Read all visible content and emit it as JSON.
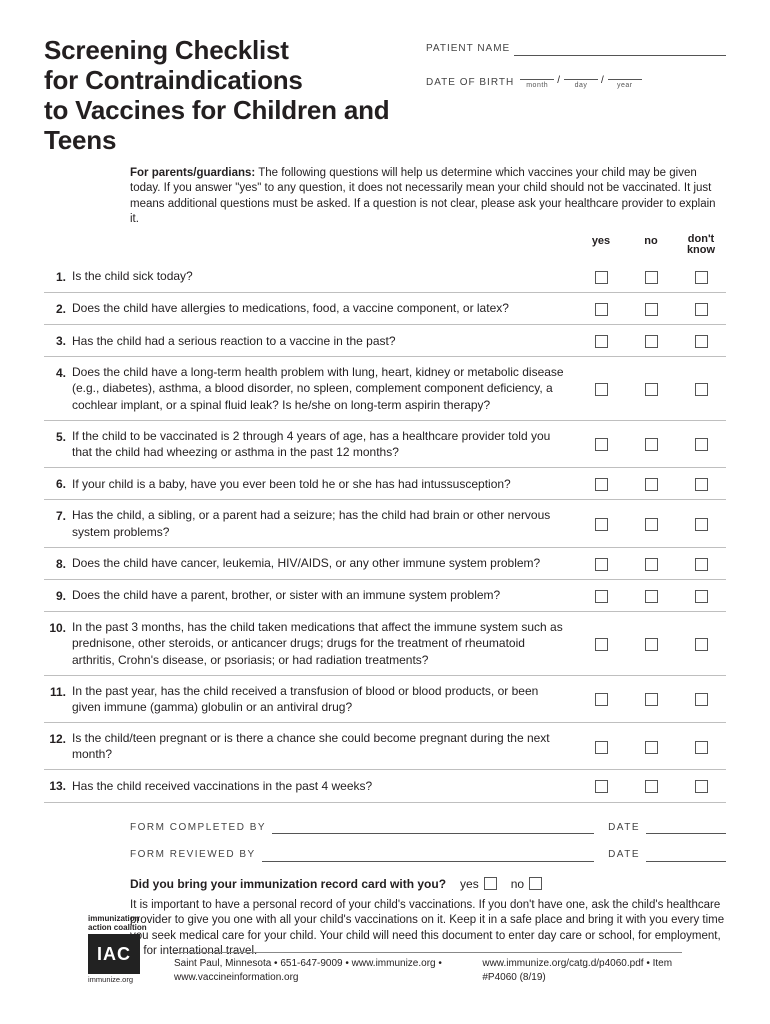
{
  "title_line1": "Screening Checklist",
  "title_line2": "for Contraindications",
  "title_line3": "to Vaccines for Children and Teens",
  "patient_name_label": "PATIENT NAME",
  "dob_label": "DATE OF BIRTH",
  "dob_month": "month",
  "dob_day": "day",
  "dob_year": "year",
  "intro_bold": "For parents/guardians:",
  "intro_text": " The following questions will help us determine which vaccines your child may be given today. If you answer \"yes\" to any question, it does not necessarily mean your child should not be vaccinated. It just means additional questions must be asked. If a question is not clear, please ask your healthcare provider to explain it.",
  "col_yes": "yes",
  "col_no": "no",
  "col_dk": "don't\nknow",
  "questions": [
    "Is the child sick today?",
    "Does the child have allergies to medications, food, a vaccine component, or latex?",
    "Has the child had a serious reaction to a vaccine in the past?",
    "Does the child have a long-term health problem with lung, heart, kidney or metabolic disease (e.g., diabetes), asthma, a blood disorder, no spleen, complement component deficiency, a cochlear implant, or a spinal fluid leak? Is he/she on long-term aspirin therapy?",
    "If the child to be vaccinated is 2 through 4 years of age, has a healthcare provider told you that the child had wheezing or asthma in the past 12 months?",
    "If your child is a baby, have you ever been told he or she has had intussusception?",
    "Has the child, a sibling, or a parent had a seizure; has the child had brain or other nervous system problems?",
    "Does the child have cancer, leukemia, HIV/AIDS, or any other immune system problem?",
    "Does the child have a parent, brother, or sister with an immune system problem?",
    "In the past 3 months, has the child taken medications that affect the immune system such as prednisone, other steroids, or anticancer drugs; drugs for the treatment of rheumatoid arthritis, Crohn's disease, or psoriasis; or had radiation treatments?",
    "In the past year, has the child received a transfusion of blood or blood products, or been given immune (gamma) globulin or an antiviral drug?",
    "Is the child/teen pregnant or is there a chance she could become pregnant during the next month?",
    "Has the child received vaccinations in the past 4 weeks?"
  ],
  "completed_by_label": "FORM COMPLETED BY",
  "reviewed_by_label": "FORM REVIEWED BY",
  "date_label": "DATE",
  "record_question": "Did you bring your immunization record card with you?",
  "record_yes": "yes",
  "record_no": "no",
  "record_text": "It is important to have a personal record of your child's vaccinations. If you don't have one, ask the child's healthcare provider to give you one with all your child's vaccinations on it. Keep it in a safe place and bring it with you every time you seek medical care for your child. Your child will need this document to enter day care or school, for employment, or for international travel.",
  "org_name1": "immunization",
  "org_name2": "action coalition",
  "org_logo": "IAC",
  "org_site": "immunize.org",
  "footer_left": "Saint Paul, Minnesota • 651-647-9009 • www.immunize.org • www.vaccineinformation.org",
  "footer_right": "www.immunize.org/catg.d/p4060.pdf • Item #P4060 (8/19)"
}
